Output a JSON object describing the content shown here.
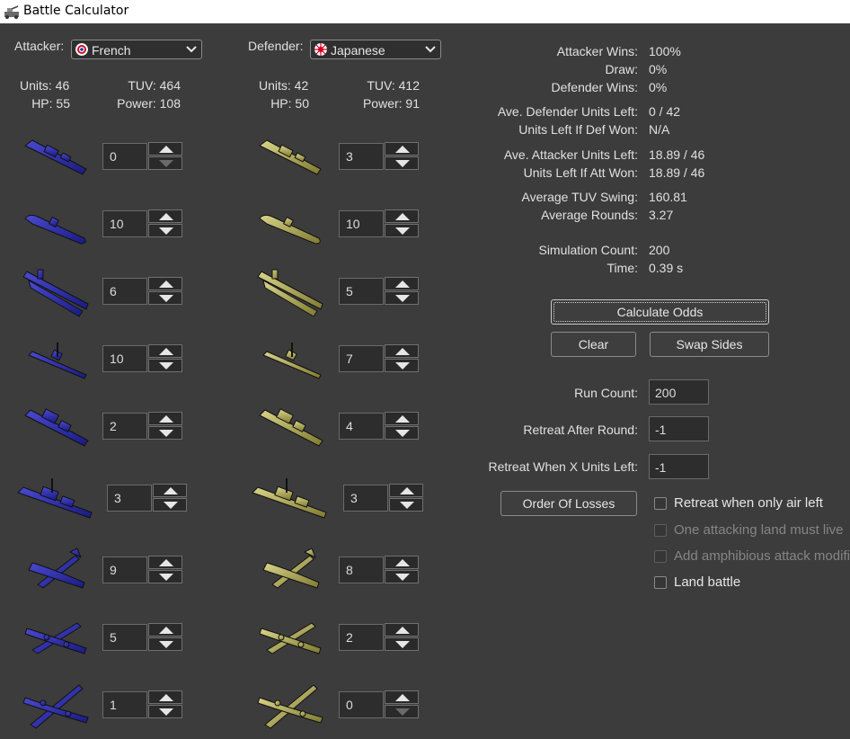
{
  "window": {
    "title": "Battle Calculator"
  },
  "attacker": {
    "label": "Attacker:",
    "nation": "French",
    "units_text": "Units: 46",
    "tuv_text": "TUV: 464",
    "hp_text": "HP: 55",
    "power_text": "Power: 108",
    "colors": {
      "units": "#2a2aa0",
      "flag_ring": "#c8102e"
    },
    "units": [
      {
        "icon": "transport-ship-icon",
        "count": "0"
      },
      {
        "icon": "submarine-icon",
        "count": "10"
      },
      {
        "icon": "carrier-icon",
        "count": "6"
      },
      {
        "icon": "destroyer-icon",
        "count": "10"
      },
      {
        "icon": "cruiser-icon",
        "count": "2"
      },
      {
        "icon": "battleship-icon",
        "count": "3"
      },
      {
        "icon": "fighter-icon",
        "count": "9"
      },
      {
        "icon": "tactical-bomber-icon",
        "count": "5"
      },
      {
        "icon": "bomber-icon",
        "count": "1"
      }
    ]
  },
  "defender": {
    "label": "Defender:",
    "nation": "Japanese",
    "units_text": "Units: 42",
    "tuv_text": "TUV: 412",
    "hp_text": "HP: 50",
    "power_text": "Power: 91",
    "colors": {
      "units": "#b5b060",
      "flag": "#d1001f"
    },
    "units": [
      {
        "icon": "transport-ship-icon",
        "count": "3"
      },
      {
        "icon": "submarine-icon",
        "count": "10"
      },
      {
        "icon": "carrier-icon",
        "count": "5"
      },
      {
        "icon": "destroyer-icon",
        "count": "7"
      },
      {
        "icon": "cruiser-icon",
        "count": "4"
      },
      {
        "icon": "battleship-icon",
        "count": "3"
      },
      {
        "icon": "fighter-icon",
        "count": "8"
      },
      {
        "icon": "tactical-bomber-icon",
        "count": "2"
      },
      {
        "icon": "bomber-icon",
        "count": "0"
      }
    ]
  },
  "results": {
    "attacker_wins_label": "Attacker Wins:",
    "attacker_wins": "100%",
    "draw_label": "Draw:",
    "draw": "0%",
    "defender_wins_label": "Defender Wins:",
    "defender_wins": "0%",
    "ave_def_left_label": "Ave. Defender Units Left:",
    "ave_def_left": "0 / 42",
    "left_if_def_won_label": "Units Left If Def Won:",
    "left_if_def_won": "N/A",
    "ave_att_left_label": "Ave. Attacker Units Left:",
    "ave_att_left": "18.89 / 46",
    "left_if_att_won_label": "Units Left If Att Won:",
    "left_if_att_won": "18.89 / 46",
    "tuv_swing_label": "Average TUV Swing:",
    "tuv_swing": "160.81",
    "avg_rounds_label": "Average Rounds:",
    "avg_rounds": "3.27",
    "sim_count_label": "Simulation Count:",
    "sim_count": "200",
    "time_label": "Time:",
    "time": "0.39 s"
  },
  "controls": {
    "calculate": "Calculate Odds",
    "clear": "Clear",
    "swap": "Swap Sides",
    "run_count_label": "Run Count:",
    "run_count": "200",
    "retreat_round_label": "Retreat After Round:",
    "retreat_round": "-1",
    "retreat_units_label": "Retreat When X Units Left:",
    "retreat_units": "-1",
    "order_of_losses": "Order Of Losses",
    "cb_air": "Retreat when only air left",
    "cb_land_live": "One attacking land must live",
    "cb_amphib": "Add amphibious attack modifiers",
    "cb_land_battle": "Land battle"
  }
}
